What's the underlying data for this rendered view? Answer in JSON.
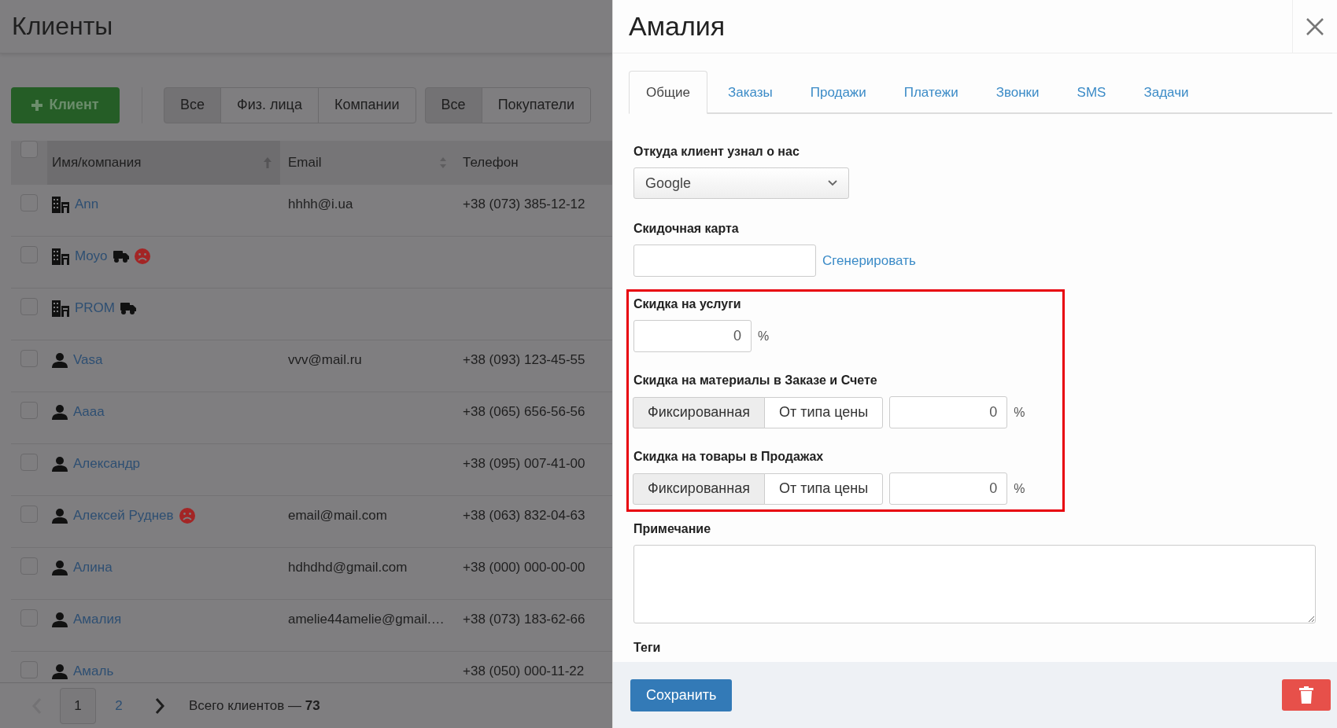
{
  "page": {
    "title": "Клиенты",
    "add_button": "Клиент",
    "type_filter": [
      {
        "label": "Все",
        "selected": true
      },
      {
        "label": "Физ. лица",
        "selected": false
      },
      {
        "label": "Компании",
        "selected": false
      }
    ],
    "role_filter": [
      {
        "label": "Все",
        "selected": true
      },
      {
        "label": "Покупатели",
        "selected": false
      }
    ]
  },
  "table": {
    "header_checked": false,
    "columns": [
      {
        "label": "Имя/компания",
        "sorted": true
      },
      {
        "label": "Email",
        "sorted": false
      },
      {
        "label": "Телефон"
      }
    ],
    "rows": [
      {
        "kind": "company",
        "name": "Ann",
        "email": "hhhh@i.ua",
        "phone": "+38 (073) 385-12-12",
        "checked": false,
        "truck": false,
        "frown": false
      },
      {
        "kind": "company",
        "name": "Moyo",
        "checked": false,
        "truck": true,
        "frown": true
      },
      {
        "kind": "company",
        "name": "PROM",
        "checked": false,
        "truck": true,
        "frown": false
      },
      {
        "kind": "person",
        "name": "Vasa",
        "email": "vvv@mail.ru",
        "phone": "+38 (093) 123-45-55",
        "checked": false,
        "truck": false,
        "frown": false
      },
      {
        "kind": "person",
        "name": "Aaaa",
        "phone": "+38 (065) 656-56-56",
        "checked": false,
        "truck": false,
        "frown": false
      },
      {
        "kind": "person",
        "name": "Александр",
        "phone": "+38 (095) 007-41-00",
        "checked": false,
        "truck": false,
        "frown": false
      },
      {
        "kind": "person",
        "name": "Алексей Руднев",
        "email": "email@mail.com",
        "phone": "+38 (063) 832-04-63",
        "checked": false,
        "truck": false,
        "frown": true
      },
      {
        "kind": "person",
        "name": "Алина",
        "email": "hdhdhd@gmail.com",
        "phone": "+38 (000) 000-00-00",
        "checked": false,
        "truck": false,
        "frown": false
      },
      {
        "kind": "person",
        "name": "Амалия",
        "email": "amelie44amelie@gmail.…",
        "phone": "+38 (073) 183-62-66",
        "checked": false,
        "truck": false,
        "frown": false
      },
      {
        "kind": "person",
        "name": "Амаль",
        "phone": "+38 (050) 000-11-22",
        "checked": false,
        "truck": false,
        "frown": false
      }
    ]
  },
  "pagination": {
    "prev_disabled": true,
    "pages": [
      {
        "label": "1",
        "selected": true
      },
      {
        "label": "2",
        "selected": false
      }
    ],
    "total": "Всего клиентов — **73**"
  },
  "panel": {
    "title": "Амалия",
    "tabs": [
      {
        "label": "Общие",
        "selected": true
      },
      {
        "label": "Заказы",
        "selected": false
      },
      {
        "label": "Продажи",
        "selected": false
      },
      {
        "label": "Платежи",
        "selected": false
      },
      {
        "label": "Звонки",
        "selected": false
      },
      {
        "label": "SMS",
        "selected": false
      },
      {
        "label": "Задачи",
        "selected": false
      }
    ],
    "source": {
      "label": "Откуда клиент узнал о нас",
      "value": "Google"
    },
    "card": {
      "label": "Скидочная карта",
      "link": "Сгенерировать"
    },
    "service_discount": {
      "label": "Скидка на услуги",
      "value": "0",
      "unit": "%"
    },
    "discounts": [
      {
        "label": "Скидка на материалы в Заказе и Счете",
        "modes": [
          {
            "label": "Фиксированная",
            "selected": true
          },
          {
            "label": "От типа цены",
            "selected": false
          }
        ],
        "value": "0",
        "unit": "%"
      },
      {
        "label": "Скидка на товары в Продажах",
        "modes": [
          {
            "label": "Фиксированная",
            "selected": true
          },
          {
            "label": "От типа цены",
            "selected": false
          }
        ],
        "value": "0",
        "unit": "%"
      }
    ],
    "note": {
      "label": "Примечание"
    },
    "tags": {
      "label": "Теги"
    },
    "save_button": "Сохранить"
  }
}
